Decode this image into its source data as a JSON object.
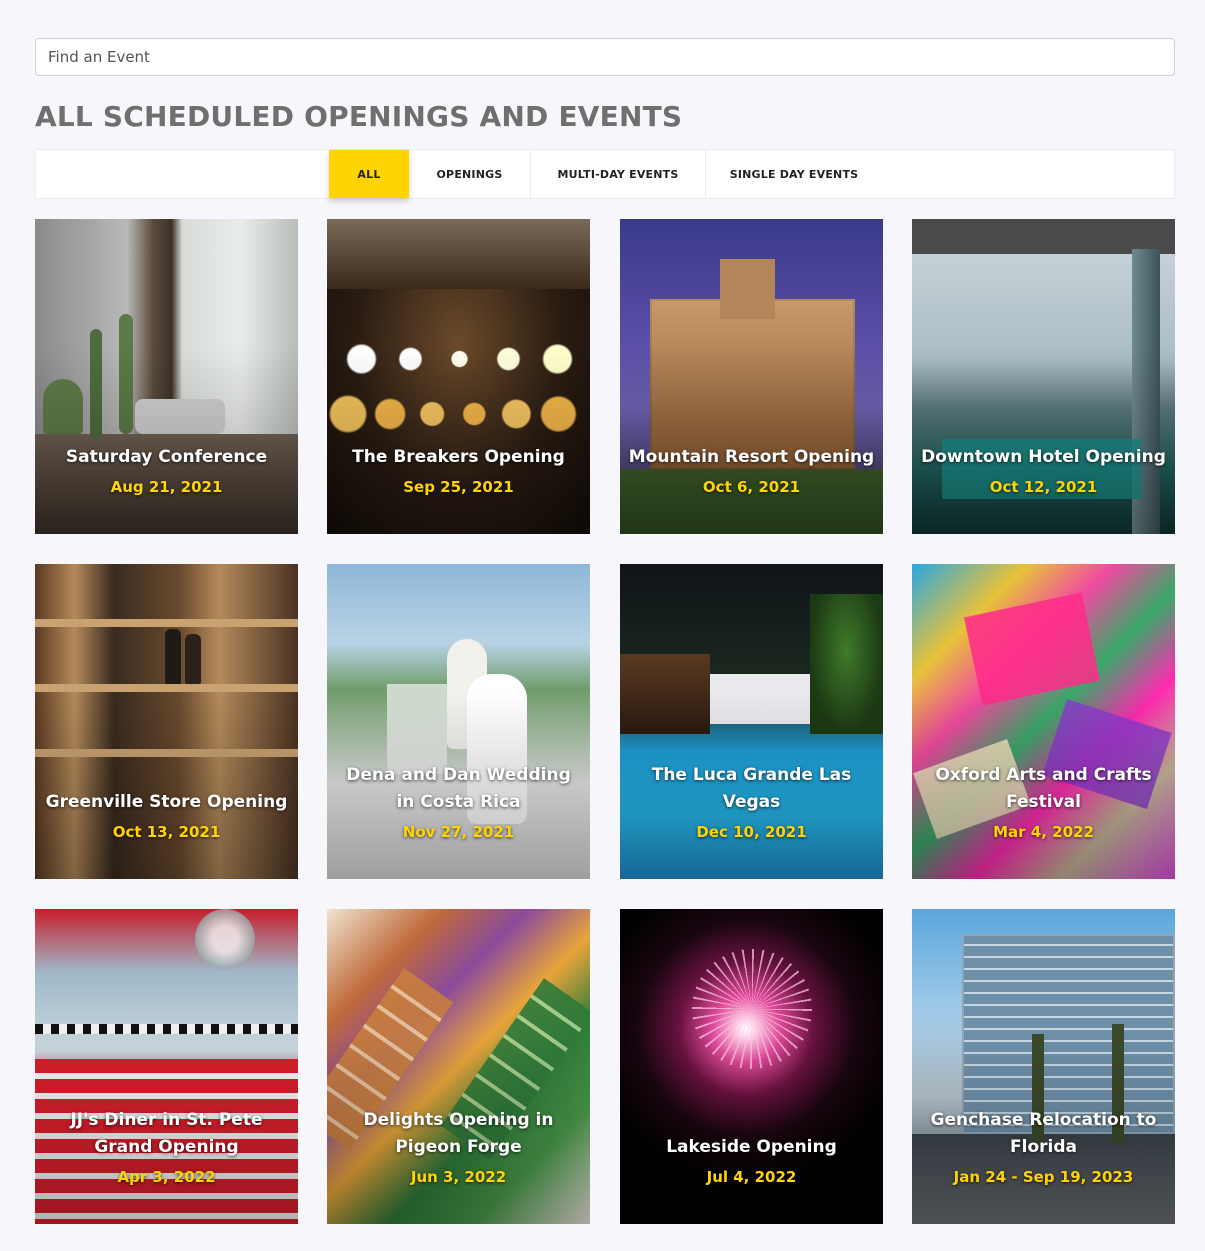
{
  "search": {
    "placeholder": "Find an Event",
    "value": ""
  },
  "page_title": "ALL SCHEDULED OPENINGS AND EVENTS",
  "filters": [
    {
      "label": "ALL",
      "active": true
    },
    {
      "label": "OPENINGS",
      "active": false
    },
    {
      "label": "MULTI-DAY EVENTS",
      "active": false
    },
    {
      "label": "SINGLE DAY EVENTS",
      "active": false
    }
  ],
  "events": [
    {
      "title": "Saturday Conference",
      "date": "Aug 21, 2021",
      "image": "living-room-cactus-photo"
    },
    {
      "title": "The Breakers Opening",
      "date": "Sep 25, 2021",
      "image": "string-lights-bokeh-photo"
    },
    {
      "title": "Mountain Resort Opening",
      "date": "Oct 6, 2021",
      "image": "resort-hotel-dusk-photo"
    },
    {
      "title": "Downtown Hotel Opening",
      "date": "Oct 12, 2021",
      "image": "hotel-lobby-teal-photo"
    },
    {
      "title": "Greenville Store Opening",
      "date": "Oct 13, 2021",
      "image": "store-shelves-bottles-photo"
    },
    {
      "title": "Dena and Dan Wedding in Costa Rica",
      "date": "Nov 27, 2021",
      "image": "beach-wedding-couple-photo"
    },
    {
      "title": "The Luca Grande Las Vegas",
      "date": "Dec 10, 2021",
      "image": "night-pool-palms-photo"
    },
    {
      "title": "Oxford Arts and Crafts Festival",
      "date": "Mar 4, 2022",
      "image": "colorful-paper-craft-photo"
    },
    {
      "title": "JJ's Diner in St. Pete Grand Opening",
      "date": "Apr 3, 2022",
      "image": "retro-diner-booths-photo"
    },
    {
      "title": "Delights Opening in Pigeon Forge",
      "date": "Jun 3, 2022",
      "image": "macarons-display-photo"
    },
    {
      "title": "Lakeside Opening",
      "date": "Jul 4, 2022",
      "image": "fireworks-night-photo"
    },
    {
      "title": "Genchase Relocation to Florida",
      "date": "Jan 24 - Sep 19, 2023",
      "image": "glass-office-building-photo"
    }
  ],
  "colors": {
    "accent": "#ffd400",
    "title": "#6f6f6f",
    "background": "#f7f7fb"
  }
}
